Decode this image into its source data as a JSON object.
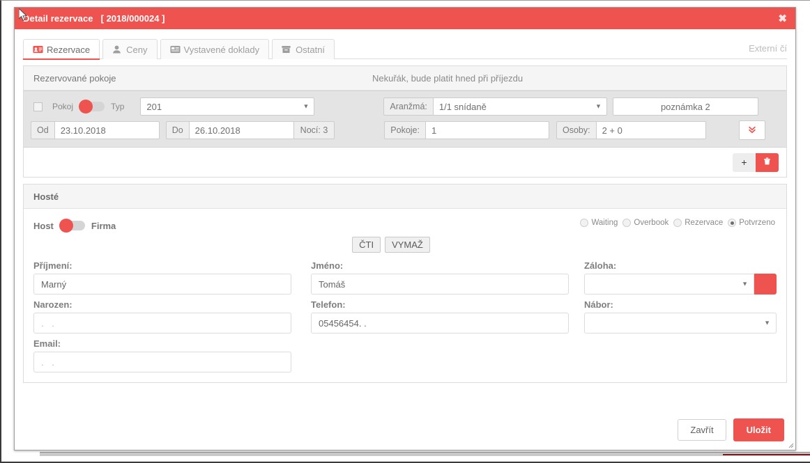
{
  "window": {
    "title": "Detail rezervace",
    "reservation_number": "[ 2018/000024 ]",
    "close_icon": "close-x",
    "accent_color": "#ef5350"
  },
  "tabs": [
    {
      "label": "Rezervace",
      "icon": "id-card-icon",
      "active": true
    },
    {
      "label": "Ceny",
      "icon": "person-icon",
      "active": false
    },
    {
      "label": "Vystavené doklady",
      "icon": "card-document-icon",
      "active": false
    },
    {
      "label": "Ostatní",
      "icon": "archive-box-icon",
      "active": false
    }
  ],
  "external_field_label": "Externí čí",
  "rooms_panel": {
    "title": "Rezervované pokoje",
    "note": "Nekuřák, bude platit hned při příjezdu",
    "row": {
      "checkbox_checked": false,
      "toggle_left_label": "Pokoj",
      "toggle_right_label": "Typ",
      "toggle_state": "left",
      "room_select_value": "201",
      "arrangement_label": "Aranžmá:",
      "arrangement_value": "1/1 snídaně",
      "note_value": "poznámka 2",
      "from_label": "Od",
      "from_value": "23.10.2018",
      "to_label": "Do",
      "to_value": "26.10.2018",
      "nights_text": "Nocí: 3",
      "rooms_label": "Pokoje:",
      "rooms_value": "1",
      "persons_label": "Osoby:",
      "persons_value": "2 + 0",
      "expand_icon": "chevron-double-down-icon"
    },
    "add_icon": "plus-icon",
    "delete_icon": "trash-icon"
  },
  "guests_panel": {
    "title": "Hosté",
    "toggle_left_label": "Host",
    "toggle_right_label": "Firma",
    "toggle_state": "left",
    "status_radios": [
      {
        "label": "Waiting",
        "selected": false
      },
      {
        "label": "Overbook",
        "selected": false
      },
      {
        "label": "Rezervace",
        "selected": false
      },
      {
        "label": "Potvrzeno",
        "selected": true
      }
    ],
    "read_button": "ČTI",
    "clear_button": "VYMAŽ",
    "fields": {
      "surname_label": "Příjmení:",
      "surname_value": "Marný",
      "firstname_label": "Jméno:",
      "firstname_value": "Tomáš",
      "deposit_label": "Záloha:",
      "deposit_value": "",
      "birth_label": "Narozen:",
      "birth_value": ". .",
      "phone_label": "Telefon:",
      "phone_value": "05456454. .",
      "recruit_label": "Nábor:",
      "recruit_value": "",
      "email_label": "Email:",
      "email_value": ". ."
    }
  },
  "footer": {
    "close_label": "Zavřít",
    "save_label": "Uložit"
  }
}
